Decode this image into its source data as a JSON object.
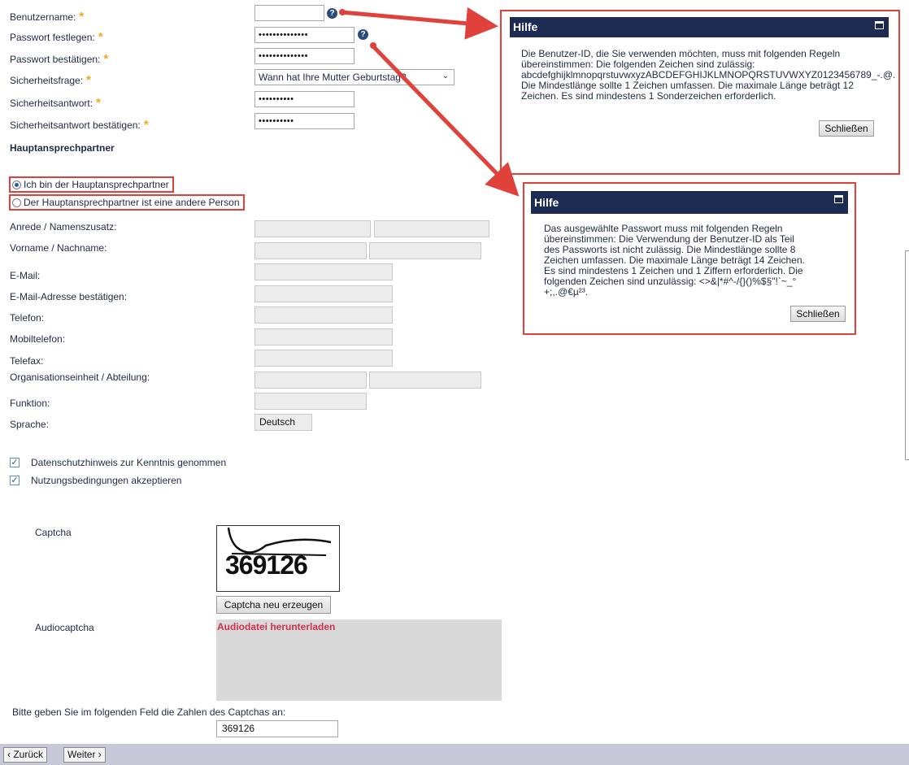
{
  "form": {
    "username_label": "Benutzername:",
    "password_label": "Passwort festlegen:",
    "password_confirm_label": "Passwort bestätigen:",
    "security_question_label": "Sicherheitsfrage:",
    "security_answer_label": "Sicherheitsantwort:",
    "security_answer_confirm_label": "Sicherheitsantwort bestätigen:",
    "required_mark": "*",
    "help_icon_glyph": "?",
    "password_value": "••••••••••••••",
    "password_confirm_value": "••••••••••••••",
    "security_question_value": "Wann hat Ihre Mutter Geburtstag?",
    "security_answer_value": "••••••••••",
    "security_answer_confirm_value": "••••••••••"
  },
  "contact": {
    "section_title": "Hauptansprechpartner",
    "radio_self": "Ich bin der Hauptansprechpartner",
    "radio_other": "Der Hauptansprechpartner ist eine andere Person",
    "salutation_label": "Anrede  /  Namenszusatz:",
    "name_label": "Vorname  /  Nachname:",
    "email_label": "E-Mail:",
    "email_confirm_label": "E-Mail-Adresse bestätigen:",
    "phone_label": "Telefon:",
    "mobile_label": "Mobiltelefon:",
    "fax_label": "Telefax:",
    "org_label": "Organisationseinheit  /  Abteilung:",
    "function_label": "Funktion:",
    "language_label": "Sprache:",
    "language_value": "Deutsch"
  },
  "consent": {
    "privacy": "Datenschutzhinweis zur Kenntnis genommen",
    "terms": "Nutzungsbedingungen akzeptieren",
    "check_glyph": "✓"
  },
  "captcha": {
    "label": "Captcha",
    "image_text": "369126",
    "regenerate_button": "Captcha neu erzeugen",
    "audio_label": "Audiocaptcha",
    "audio_link": "Audiodatei herunterladen",
    "instruction": "Bitte geben Sie im folgenden Feld die Zahlen des Captchas an:",
    "input_value": "369126"
  },
  "help1": {
    "title": "Hilfe",
    "text": "Die Benutzer-ID, die Sie verwenden möchten, muss mit folgenden Regeln übereinstimmen: Die folgenden Zeichen sind zulässig: abcdefghijklmnopqrstuvwxyzABCDEFGHIJKLMNOPQRSTUVWXYZ0123456789_-.@. Die Mindestlänge sollte 1 Zeichen umfassen. Die maximale Länge beträgt 12 Zeichen. Es sind mindestens 1 Sonderzeichen erforderlich.",
    "close_button": "Schließen"
  },
  "help2": {
    "title": "Hilfe",
    "text": "Das ausgewählte Passwort muss mit folgenden Regeln übereinstimmen: Die Verwendung der Benutzer-ID als Teil des Passworts ist nicht zulässig. Die Mindestlänge sollte 8 Zeichen umfassen. Die maximale Länge beträgt 14 Zeichen. Es sind mindestens 1 Zeichen und 1 Ziffern erforderlich. Die folgenden Zeichen sind unzulässig: <>&|*#^-/{}()%$§\"!`~_°+;,.@€µ²³.",
    "close_button": "Schließen"
  },
  "nav": {
    "back": "‹ Zurück",
    "next": "Weiter ›"
  },
  "colors": {
    "annotation_red": "#e0413a",
    "dialog_header": "#1d2a52",
    "required_star": "#f5a623",
    "audio_link": "#d0304a"
  }
}
